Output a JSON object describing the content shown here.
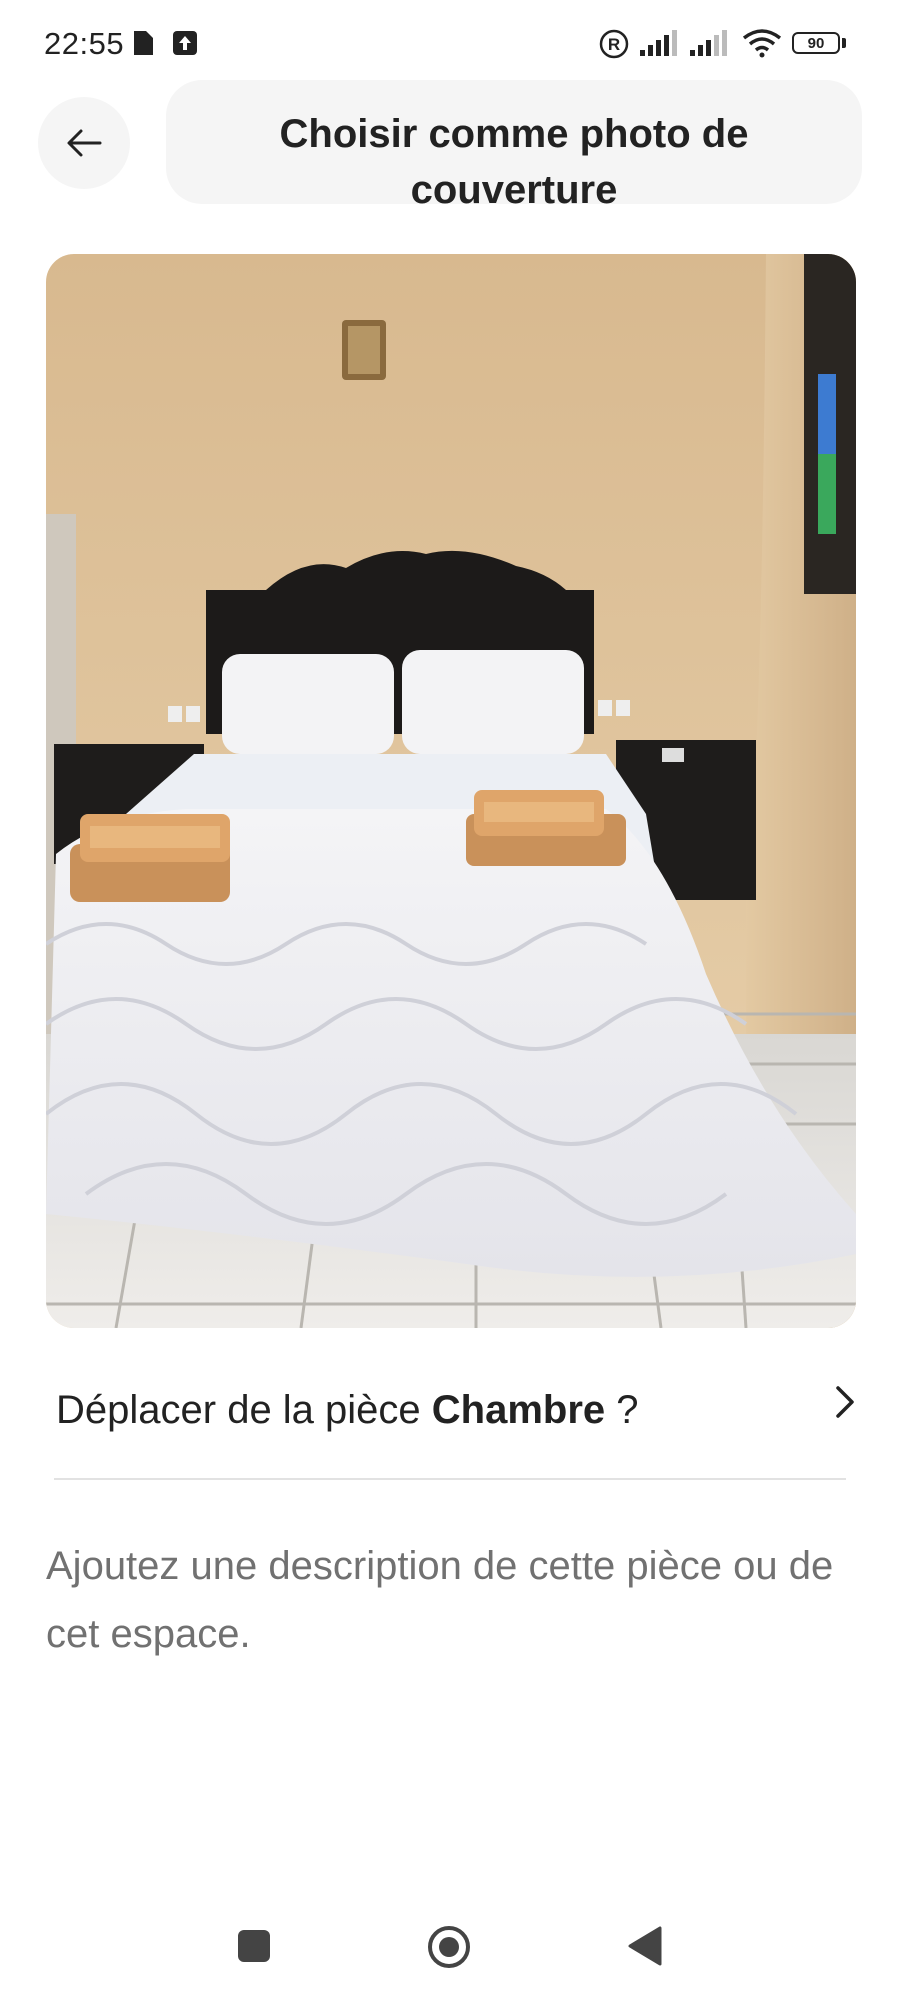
{
  "status_bar": {
    "time": "22:55",
    "battery": "90",
    "icons": [
      "document-icon",
      "upload-icon",
      "registered-icon",
      "signal-icon",
      "signal-icon",
      "wifi-icon",
      "battery-icon"
    ]
  },
  "header": {
    "back_icon": "arrow-left-icon",
    "title": "Choisir comme photo de couverture"
  },
  "photo": {
    "subject": "bedroom-photo"
  },
  "move_room": {
    "prefix": "Déplacer de la pièce ",
    "room": "Chambre",
    "suffix": " ?",
    "icon": "chevron-right-icon"
  },
  "description": {
    "placeholder": "Ajoutez une description de cette pièce ou de cet espace."
  },
  "nav_bar": {
    "icons": [
      "recents-square-icon",
      "home-circle-icon",
      "back-triangle-icon"
    ]
  },
  "colors": {
    "text": "#222222",
    "muted": "#717171",
    "pill": "#f5f5f5",
    "divider": "#e2e2e2"
  }
}
